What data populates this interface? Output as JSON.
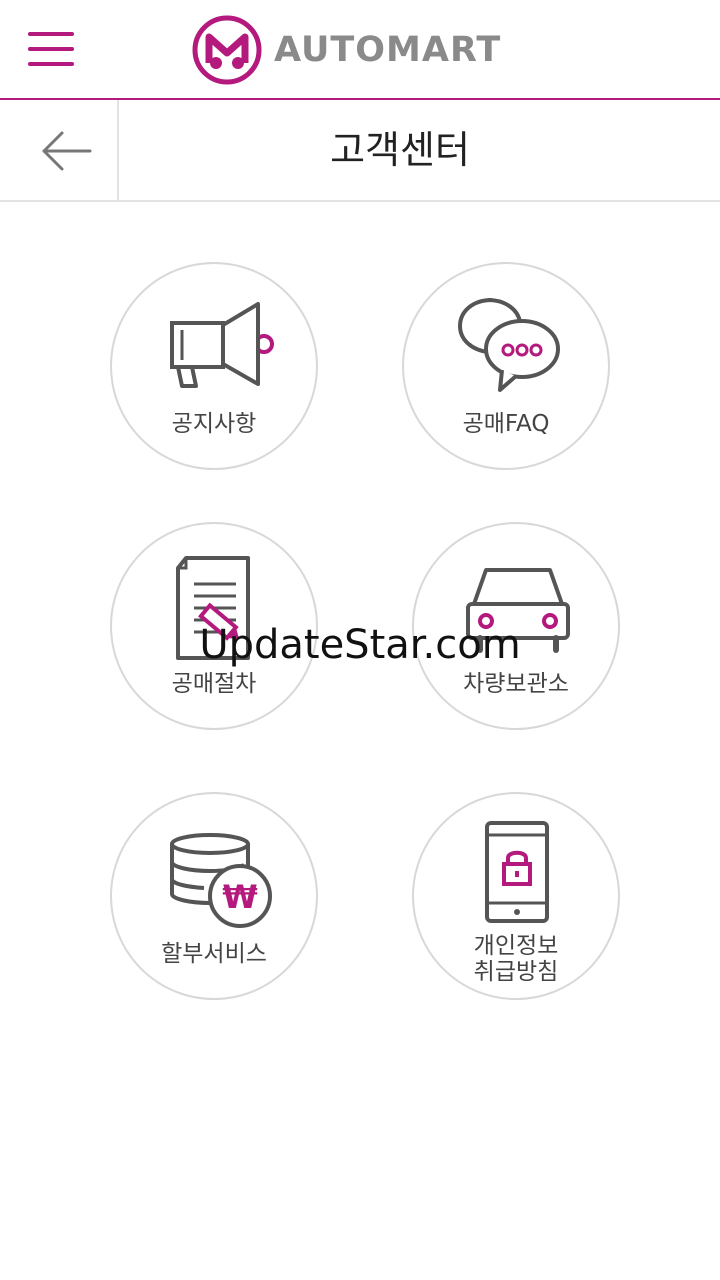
{
  "app": {
    "brand": "AUTOMART",
    "logo_letter": "M",
    "accent_color": "#b4197e"
  },
  "header": {
    "menu_icon": "hamburger-menu-icon",
    "back_icon": "arrow-left-icon",
    "title": "고객센터"
  },
  "menu": [
    {
      "label": "공지사항",
      "icon": "megaphone-icon"
    },
    {
      "label": "공매FAQ",
      "icon": "chat-bubbles-icon"
    },
    {
      "label": "공매절차",
      "icon": "document-pencil-icon"
    },
    {
      "label": "차량보관소",
      "icon": "car-icon"
    },
    {
      "label": "할부서비스",
      "icon": "database-won-icon"
    },
    {
      "label_line1": "개인정보",
      "label_line2": "취급방침",
      "icon": "phone-lock-icon"
    }
  ],
  "watermark": "UpdateStar.com"
}
